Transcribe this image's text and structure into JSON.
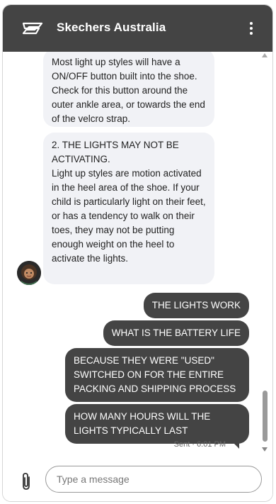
{
  "header": {
    "title": "Skechers Australia",
    "logo_icon": "skechers-s-logo",
    "menu_icon": "more-vertical-icon",
    "background": "#444444"
  },
  "messages": [
    {
      "from": "bot",
      "text": "Most light up styles will have a ON/OFF button built into the shoe. Check for this button around the outer ankle area, or towards the end of the velcro strap."
    },
    {
      "from": "bot",
      "text": "2. THE LIGHTS MAY NOT BE ACTIVATING.\nLight up styles are motion activated in the heel area of the shoe. If your child is particularly light on their feet, or has a tendency to walk on their toes, they may not be putting enough weight on the heel to activate the lights."
    },
    {
      "from": "user",
      "text": "THE LIGHTS WORK"
    },
    {
      "from": "user",
      "text": "WHAT IS THE BATTERY LIFE"
    },
    {
      "from": "user",
      "text": "BECAUSE THEY WERE \"USED\" SWITCHED ON FOR THE ENTIRE PACKING AND SHIPPING PROCESS"
    },
    {
      "from": "user",
      "text": "HOW MANY HOURS WILL THE LIGHTS TYPICALLY LAST"
    }
  ],
  "status": {
    "sent": "Sent · 6:01 PM"
  },
  "composer": {
    "placeholder": "Type a message",
    "attach_icon": "paperclip-icon"
  },
  "colors": {
    "bot_bubble": "#f1f2f6",
    "user_bubble": "#444444"
  }
}
